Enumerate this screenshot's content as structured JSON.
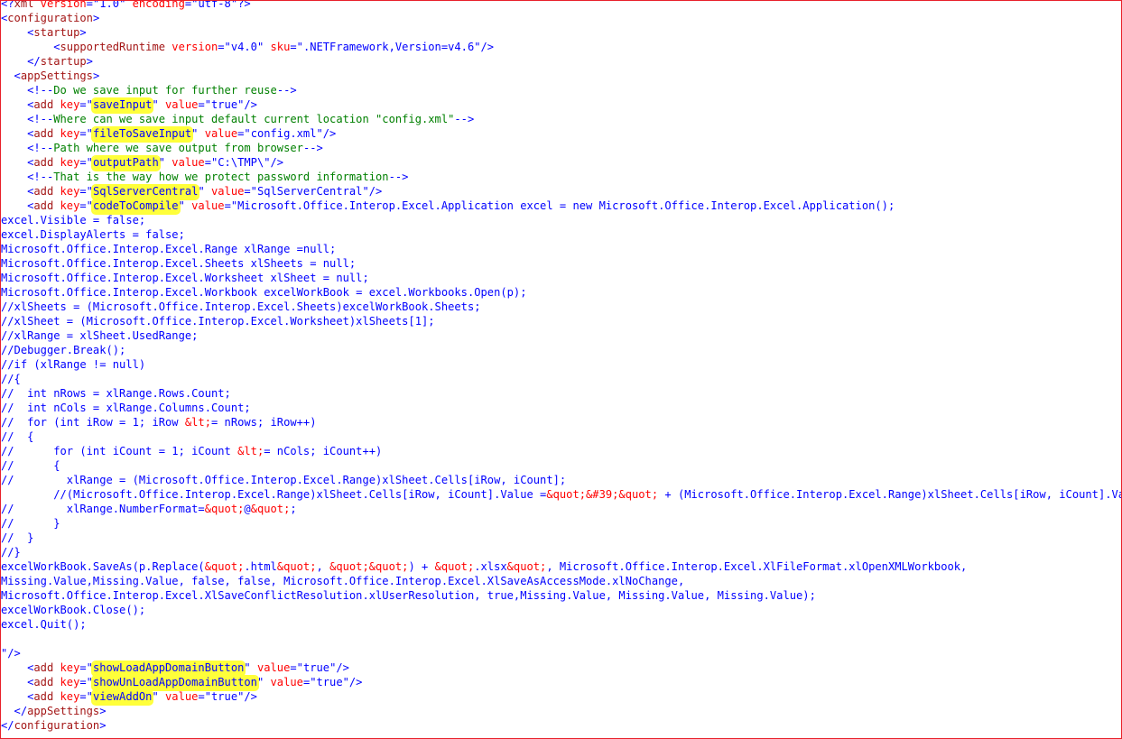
{
  "lines": [
    [
      [
        "t-blue",
        "<?"
      ],
      [
        "t-tag",
        "xml"
      ],
      [
        "t-attr",
        " version"
      ],
      [
        "t-blue",
        "=\""
      ],
      [
        "t-txt",
        "1.0"
      ],
      [
        "t-blue",
        "\""
      ],
      [
        "t-attr",
        " encoding"
      ],
      [
        "t-blue",
        "=\""
      ],
      [
        "t-txt",
        "utf-8"
      ],
      [
        "t-blue",
        "\"?>"
      ]
    ],
    [
      [
        "t-blue",
        "<"
      ],
      [
        "t-tag",
        "configuration"
      ],
      [
        "t-blue",
        ">"
      ]
    ],
    [
      [
        "t-blue",
        "    <"
      ],
      [
        "t-tag",
        "startup"
      ],
      [
        "t-blue",
        ">"
      ]
    ],
    [
      [
        "t-blue",
        "        <"
      ],
      [
        "t-tag",
        "supportedRuntime"
      ],
      [
        "t-attr",
        " version"
      ],
      [
        "t-blue",
        "=\""
      ],
      [
        "t-txt",
        "v4.0"
      ],
      [
        "t-blue",
        "\""
      ],
      [
        "t-attr",
        " sku"
      ],
      [
        "t-blue",
        "=\""
      ],
      [
        "t-txt",
        ".NETFramework,Version=v4.6"
      ],
      [
        "t-blue",
        "\"/>"
      ]
    ],
    [
      [
        "t-blue",
        "    </"
      ],
      [
        "t-tag",
        "startup"
      ],
      [
        "t-blue",
        ">"
      ]
    ],
    [
      [
        "t-blue",
        "  <"
      ],
      [
        "t-tag",
        "appSettings"
      ],
      [
        "t-blue",
        ">"
      ]
    ],
    [
      [
        "t-blue",
        "    <!--"
      ],
      [
        "t-com",
        "Do we save input for further reuse"
      ],
      [
        "t-blue",
        "-->"
      ]
    ],
    [
      [
        "t-blue",
        "    <"
      ],
      [
        "t-tag",
        "add"
      ],
      [
        "t-attr",
        " key"
      ],
      [
        "t-blue",
        "=\""
      ],
      [
        "t-txt hl",
        "saveInput"
      ],
      [
        "t-blue",
        "\""
      ],
      [
        "t-attr",
        " value"
      ],
      [
        "t-blue",
        "=\""
      ],
      [
        "t-txt",
        "true"
      ],
      [
        "t-blue",
        "\"/>"
      ]
    ],
    [
      [
        "t-blue",
        "    <!--"
      ],
      [
        "t-com",
        "Where can we save input default current location \"config.xml\""
      ],
      [
        "t-blue",
        "-->"
      ]
    ],
    [
      [
        "t-blue",
        "    <"
      ],
      [
        "t-tag",
        "add"
      ],
      [
        "t-attr",
        " key"
      ],
      [
        "t-blue",
        "=\""
      ],
      [
        "t-txt hl",
        "fileToSaveInput"
      ],
      [
        "t-blue",
        "\""
      ],
      [
        "t-attr",
        " value"
      ],
      [
        "t-blue",
        "=\""
      ],
      [
        "t-txt",
        "config.xml"
      ],
      [
        "t-blue",
        "\"/>"
      ]
    ],
    [
      [
        "t-blue",
        "    <!--"
      ],
      [
        "t-com",
        "Path where we save output from browser"
      ],
      [
        "t-blue",
        "-->"
      ]
    ],
    [
      [
        "t-blue",
        "    <"
      ],
      [
        "t-tag",
        "add"
      ],
      [
        "t-attr",
        " key"
      ],
      [
        "t-blue",
        "=\""
      ],
      [
        "t-txt hl",
        "outputPath"
      ],
      [
        "t-blue",
        "\""
      ],
      [
        "t-attr",
        " value"
      ],
      [
        "t-blue",
        "=\""
      ],
      [
        "t-txt",
        "C:\\TMP\\"
      ],
      [
        "t-blue",
        "\"/>"
      ]
    ],
    [
      [
        "t-blue",
        "    <!--"
      ],
      [
        "t-com",
        "That is the way how we protect password information"
      ],
      [
        "t-blue",
        "-->"
      ]
    ],
    [
      [
        "t-blue",
        "    <"
      ],
      [
        "t-tag",
        "add"
      ],
      [
        "t-attr",
        " key"
      ],
      [
        "t-blue",
        "=\""
      ],
      [
        "t-txt hl",
        "SqlServerCentral"
      ],
      [
        "t-blue",
        "\""
      ],
      [
        "t-attr",
        " value"
      ],
      [
        "t-blue",
        "=\""
      ],
      [
        "t-txt",
        "SqlServerCentral"
      ],
      [
        "t-blue",
        "\"/>"
      ]
    ],
    [
      [
        "t-blue",
        "    <"
      ],
      [
        "t-tag",
        "add"
      ],
      [
        "t-attr",
        " key"
      ],
      [
        "t-blue",
        "=\""
      ],
      [
        "t-txt hl",
        "codeToCompile"
      ],
      [
        "t-blue",
        "\""
      ],
      [
        "t-attr",
        " value"
      ],
      [
        "t-blue",
        "=\""
      ],
      [
        "t-txt",
        "Microsoft.Office.Interop.Excel.Application excel = new Microsoft.Office.Interop.Excel.Application();"
      ]
    ],
    [
      [
        "t-txt",
        "excel.Visible = false;"
      ]
    ],
    [
      [
        "t-txt",
        "excel.DisplayAlerts = false;"
      ]
    ],
    [
      [
        "t-txt",
        "Microsoft.Office.Interop.Excel.Range xlRange =null;"
      ]
    ],
    [
      [
        "t-txt",
        "Microsoft.Office.Interop.Excel.Sheets xlSheets = null;"
      ]
    ],
    [
      [
        "t-txt",
        "Microsoft.Office.Interop.Excel.Worksheet xlSheet = null;"
      ]
    ],
    [
      [
        "t-txt",
        "Microsoft.Office.Interop.Excel.Workbook excelWorkBook = excel.Workbooks.Open(p);"
      ]
    ],
    [
      [
        "t-txt",
        "//xlSheets = (Microsoft.Office.Interop.Excel.Sheets)excelWorkBook.Sheets;"
      ]
    ],
    [
      [
        "t-txt",
        "//xlSheet = (Microsoft.Office.Interop.Excel.Worksheet)xlSheets[1];"
      ]
    ],
    [
      [
        "t-txt",
        "//xlRange = xlSheet.UsedRange;"
      ]
    ],
    [
      [
        "t-txt",
        "//Debugger.Break();"
      ]
    ],
    [
      [
        "t-txt",
        "//if (xlRange != null)"
      ]
    ],
    [
      [
        "t-txt",
        "//{"
      ]
    ],
    [
      [
        "t-txt",
        "//  int nRows = xlRange.Rows.Count;"
      ]
    ],
    [
      [
        "t-txt",
        "//  int nCols = xlRange.Columns.Count;"
      ]
    ],
    [
      [
        "t-txt",
        "//  for (int iRow = 1; iRow "
      ],
      [
        "t-ent",
        "&lt;"
      ],
      [
        "t-txt",
        "= nRows; iRow++)"
      ]
    ],
    [
      [
        "t-txt",
        "//  {"
      ]
    ],
    [
      [
        "t-txt",
        "//      for (int iCount = 1; iCount "
      ],
      [
        "t-ent",
        "&lt;"
      ],
      [
        "t-txt",
        "= nCols; iCount++)"
      ]
    ],
    [
      [
        "t-txt",
        "//      {"
      ]
    ],
    [
      [
        "t-txt",
        "//        xlRange = (Microsoft.Office.Interop.Excel.Range)xlSheet.Cells[iRow, iCount];"
      ]
    ],
    [
      [
        "t-txt",
        "        //(Microsoft.Office.Interop.Excel.Range)xlSheet.Cells[iRow, iCount].Value ="
      ],
      [
        "t-ent",
        "&quot;&#39;&quot;"
      ],
      [
        "t-txt",
        " + (Microsoft.Office.Interop.Excel.Range)xlSheet.Cells[iRow, iCount].Value ;"
      ]
    ],
    [
      [
        "t-txt",
        "//        xlRange.NumberFormat="
      ],
      [
        "t-ent",
        "&quot;"
      ],
      [
        "t-txt",
        "@"
      ],
      [
        "t-ent",
        "&quot;"
      ],
      [
        "t-txt",
        ";"
      ]
    ],
    [
      [
        "t-txt",
        "//      }"
      ]
    ],
    [
      [
        "t-txt",
        "//  }"
      ]
    ],
    [
      [
        "t-txt",
        "//}"
      ]
    ],
    [
      [
        "t-txt",
        "excelWorkBook.SaveAs(p.Replace("
      ],
      [
        "t-ent",
        "&quot;"
      ],
      [
        "t-txt",
        ".html"
      ],
      [
        "t-ent",
        "&quot;"
      ],
      [
        "t-txt",
        ", "
      ],
      [
        "t-ent",
        "&quot;&quot;"
      ],
      [
        "t-txt",
        ") + "
      ],
      [
        "t-ent",
        "&quot;"
      ],
      [
        "t-txt",
        ".xlsx"
      ],
      [
        "t-ent",
        "&quot;"
      ],
      [
        "t-txt",
        ", Microsoft.Office.Interop.Excel.XlFileFormat.xlOpenXMLWorkbook,"
      ]
    ],
    [
      [
        "t-txt",
        "Missing.Value,Missing.Value, false, false, Microsoft.Office.Interop.Excel.XlSaveAsAccessMode.xlNoChange,"
      ]
    ],
    [
      [
        "t-txt",
        "Microsoft.Office.Interop.Excel.XlSaveConflictResolution.xlUserResolution, true,Missing.Value, Missing.Value, Missing.Value);"
      ]
    ],
    [
      [
        "t-txt",
        "excelWorkBook.Close();"
      ]
    ],
    [
      [
        "t-txt",
        "excel.Quit();"
      ]
    ],
    [
      [
        "t-txt",
        ""
      ]
    ],
    [
      [
        "t-blue",
        "\"/>"
      ]
    ],
    [
      [
        "t-blue",
        "    <"
      ],
      [
        "t-tag",
        "add"
      ],
      [
        "t-attr",
        " key"
      ],
      [
        "t-blue",
        "=\""
      ],
      [
        "t-txt hl",
        "showLoadAppDomainButton"
      ],
      [
        "t-blue",
        "\""
      ],
      [
        "t-attr",
        " value"
      ],
      [
        "t-blue",
        "=\""
      ],
      [
        "t-txt",
        "true"
      ],
      [
        "t-blue",
        "\"/>"
      ]
    ],
    [
      [
        "t-blue",
        "    <"
      ],
      [
        "t-tag",
        "add"
      ],
      [
        "t-attr",
        " key"
      ],
      [
        "t-blue",
        "=\""
      ],
      [
        "t-txt hl",
        "showUnLoadAppDomainButton"
      ],
      [
        "t-blue",
        "\""
      ],
      [
        "t-attr",
        " value"
      ],
      [
        "t-blue",
        "=\""
      ],
      [
        "t-txt",
        "true"
      ],
      [
        "t-blue",
        "\"/>"
      ]
    ],
    [
      [
        "t-blue",
        "    <"
      ],
      [
        "t-tag",
        "add"
      ],
      [
        "t-attr",
        " key"
      ],
      [
        "t-blue",
        "=\""
      ],
      [
        "t-txt hl",
        "viewAddOn"
      ],
      [
        "t-blue",
        "\""
      ],
      [
        "t-attr",
        " value"
      ],
      [
        "t-blue",
        "=\""
      ],
      [
        "t-txt",
        "true"
      ],
      [
        "t-blue",
        "\"/>"
      ]
    ],
    [
      [
        "t-blue",
        "  </"
      ],
      [
        "t-tag",
        "appSettings"
      ],
      [
        "t-blue",
        ">"
      ]
    ],
    [
      [
        "t-blue",
        "</"
      ],
      [
        "t-tag",
        "configuration"
      ],
      [
        "t-blue",
        ">"
      ]
    ]
  ]
}
